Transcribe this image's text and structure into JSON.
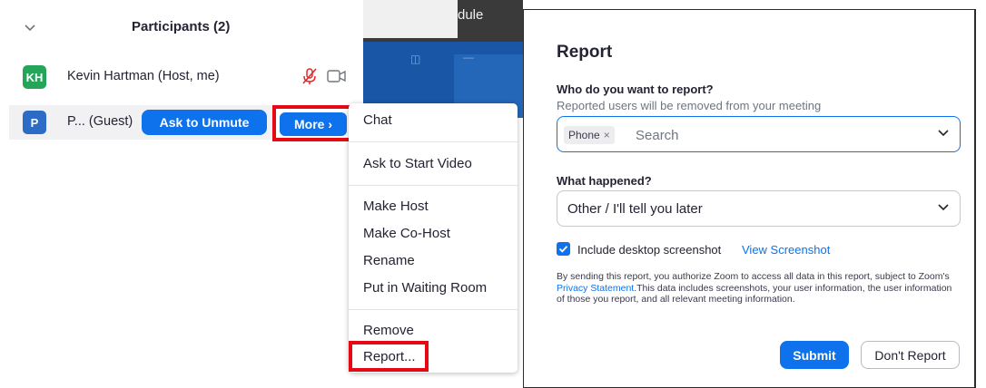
{
  "participants": {
    "title": "Participants (2)",
    "rows": [
      {
        "initials": "KH",
        "name": "Kevin Hartman (Host, me)",
        "mic_icon": "mic-muted-icon",
        "cam_icon": "video-off-icon"
      },
      {
        "initials": "P",
        "name": "P... (Guest)",
        "unmute_label": "Ask to Unmute",
        "more_label": "More ›"
      }
    ]
  },
  "background": {
    "tab_text": "dule"
  },
  "menu": {
    "items": [
      "Chat",
      "Ask to Start Video",
      "Make Host",
      "Make Co-Host",
      "Rename",
      "Put in Waiting Room",
      "Remove",
      "Report..."
    ]
  },
  "dialog": {
    "title": "Report",
    "who_label": "Who do you want to report?",
    "who_hint": "Reported users will be removed from your meeting",
    "chip_label": "Phone",
    "chip_remove": "×",
    "search_placeholder": "Search",
    "what_label": "What happened?",
    "what_value": "Other / I'll tell you later",
    "include_label": "Include desktop screenshot",
    "include_checked": true,
    "view_link": "View Screenshot",
    "legal_part1": "By sending this report, you authorize Zoom to access all data in this report, subject to Zoom's ",
    "legal_link": "Privacy Statement",
    "legal_part2": ".This data includes screenshots, your user information, the user information of those you report, and all relevant meeting information.",
    "submit_label": "Submit",
    "dont_label": "Don't Report"
  },
  "colors": {
    "accent": "#0e72ed",
    "highlight": "#e50914",
    "avatar_kh": "#25a55a",
    "avatar_p": "#2d6cc6"
  }
}
